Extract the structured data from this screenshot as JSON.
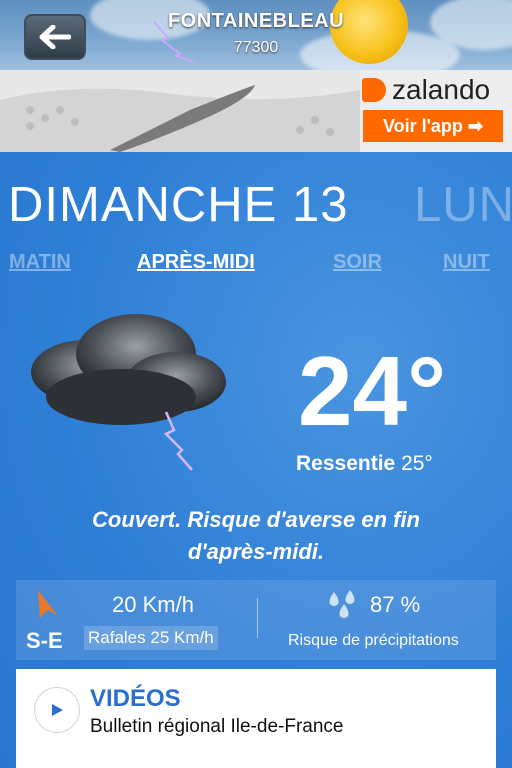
{
  "header": {
    "city": "FONTAINEBLEAU",
    "zip": "77300",
    "back_icon": "arrow-left-icon"
  },
  "ad": {
    "brand": "zalando",
    "cta": "Voir l'app ➡",
    "brand_color": "#ff6900"
  },
  "forecast": {
    "day_current": "DIMANCHE 13",
    "day_next": "LUN",
    "periods": [
      "MATIN",
      "APRÈS-MIDI",
      "SOIR",
      "NUIT"
    ],
    "active_period": "APRÈS-MIDI",
    "condition_icon": "storm-cloud-icon",
    "temperature": "24°",
    "feels_label": "Ressentie",
    "feels_value": "25°",
    "description_line1": "Couvert. Risque d'averse en fin",
    "description_line2": "d'après-midi."
  },
  "stats": {
    "wind_speed": "20 Km/h",
    "wind_direction": "S-E",
    "gusts": "Rafales 25 Km/h",
    "precip_value": "87 %",
    "precip_label": "Risque de précipitations"
  },
  "video": {
    "title": "VIDÉOS",
    "subtitle": "Bulletin régional Ile-de-France",
    "accent": "#2a6fcf"
  }
}
